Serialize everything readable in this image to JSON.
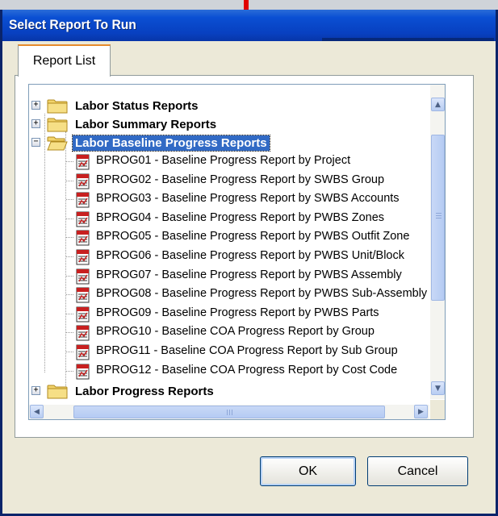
{
  "window": {
    "title": "Select Report To Run"
  },
  "tabs": [
    {
      "label": "Report List",
      "selected": true
    }
  ],
  "tree": {
    "categories": [
      {
        "label": "Labor  Status Reports",
        "expanded": false
      },
      {
        "label": "Labor  Summary Reports",
        "expanded": false
      },
      {
        "label": "Labor Baseline Progress Reports",
        "expanded": true,
        "selected": true,
        "reports": [
          "BPROG01 - Baseline Progress Report by Project",
          "BPROG02 - Baseline Progress Report by SWBS Group",
          "BPROG03 - Baseline Progress Report by SWBS Accounts",
          "BPROG04 - Baseline Progress Report by PWBS Zones",
          "BPROG05 - Baseline Progress Report by PWBS Outfit  Zone",
          "BPROG06 - Baseline Progress Report by PWBS Unit/Block",
          "BPROG07 - Baseline Progress Report by PWBS Assembly",
          "BPROG08 - Baseline Progress Report by PWBS Sub-Assembly",
          "BPROG09 - Baseline Progress Report by PWBS Parts",
          "BPROG10 - Baseline COA Progress Report by Group",
          "BPROG11 - Baseline COA Progress Report by Sub Group",
          "BPROG12 - Baseline COA Progress Report by Cost Code"
        ]
      },
      {
        "label": "Labor Progress Reports",
        "expanded": false
      }
    ]
  },
  "buttons": {
    "ok": "OK",
    "cancel": "Cancel"
  },
  "icons": {
    "expand": "plus-box-icon",
    "collapse": "minus-box-icon",
    "folder": "folder-icon",
    "folder_open": "folder-open-icon",
    "report": "report-icon"
  },
  "colors": {
    "title_bar": "#0a4fd3",
    "selection": "#316ac5",
    "tab_accent": "#e68b2c",
    "folder": "#f2d36b"
  }
}
